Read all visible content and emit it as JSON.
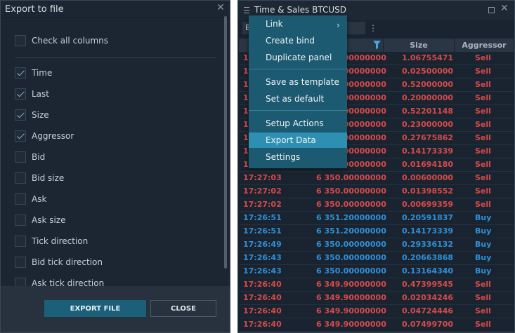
{
  "export_dialog": {
    "title": "Export to file",
    "check_all": "Check all columns",
    "columns": [
      {
        "label": "Time",
        "checked": true
      },
      {
        "label": "Last",
        "checked": true
      },
      {
        "label": "Size",
        "checked": true
      },
      {
        "label": "Aggressor",
        "checked": true
      },
      {
        "label": "Bid",
        "checked": false
      },
      {
        "label": "Bid size",
        "checked": false
      },
      {
        "label": "Ask",
        "checked": false
      },
      {
        "label": "Ask size",
        "checked": false
      },
      {
        "label": "Tick direction",
        "checked": false
      },
      {
        "label": "Bid tick direction",
        "checked": false
      },
      {
        "label": "Ask tick direction",
        "checked": false
      }
    ],
    "export_label": "EXPORT FILE",
    "close_label": "CLOSE"
  },
  "time_sales": {
    "title": "Time & Sales BTCUSD",
    "toolbar_value": "B",
    "headers": {
      "size": "Size",
      "aggressor": "Aggressor"
    },
    "rows": [
      {
        "time": "17:27:08",
        "price": "6 350.00000000",
        "size": "1.06755471",
        "aggressor": "Sell"
      },
      {
        "time": "17:27:08",
        "price": "6 350.00000000",
        "size": "0.02500000",
        "aggressor": "Sell"
      },
      {
        "time": "17:27:08",
        "price": "6 350.00000000",
        "size": "0.52000000",
        "aggressor": "Sell"
      },
      {
        "time": "17:27:08",
        "price": "6 350.00000000",
        "size": "0.20000000",
        "aggressor": "Sell"
      },
      {
        "time": "17:27:08",
        "price": "6 350.00000000",
        "size": "0.52201148",
        "aggressor": "Sell"
      },
      {
        "time": "17:27:08",
        "price": "6 350.00000000",
        "size": "0.23000000",
        "aggressor": "Sell"
      },
      {
        "time": "17:27:08",
        "price": "6 350.00000000",
        "size": "0.27675862",
        "aggressor": "Sell"
      },
      {
        "time": "17:27:08",
        "price": "6 350.00000000",
        "size": "0.14173339",
        "aggressor": "Sell"
      },
      {
        "time": "17:27:08",
        "price": "6 350.00000000",
        "size": "0.01694180",
        "aggressor": "Sell"
      },
      {
        "time": "17:27:03",
        "price": "6 350.00000000",
        "size": "0.00600000",
        "aggressor": "Sell"
      },
      {
        "time": "17:27:02",
        "price": "6 350.00000000",
        "size": "0.01398552",
        "aggressor": "Sell"
      },
      {
        "time": "17:27:02",
        "price": "6 350.00000000",
        "size": "0.00699359",
        "aggressor": "Sell"
      },
      {
        "time": "17:26:51",
        "price": "6 351.20000000",
        "size": "0.20591837",
        "aggressor": "Buy"
      },
      {
        "time": "17:26:51",
        "price": "6 351.20000000",
        "size": "0.14173339",
        "aggressor": "Buy"
      },
      {
        "time": "17:26:49",
        "price": "6 350.00000000",
        "size": "0.29336132",
        "aggressor": "Buy"
      },
      {
        "time": "17:26:43",
        "price": "6 350.00000000",
        "size": "0.20663868",
        "aggressor": "Buy"
      },
      {
        "time": "17:26:43",
        "price": "6 350.00000000",
        "size": "0.13164340",
        "aggressor": "Buy"
      },
      {
        "time": "17:26:40",
        "price": "6 349.90000000",
        "size": "0.47399545",
        "aggressor": "Sell"
      },
      {
        "time": "17:26:40",
        "price": "6 349.90000000",
        "size": "0.02034246",
        "aggressor": "Sell"
      },
      {
        "time": "17:26:40",
        "price": "6 349.90000000",
        "size": "0.04724446",
        "aggressor": "Sell"
      },
      {
        "time": "17:26:40",
        "price": "6 349.90000000",
        "size": "0.07499700",
        "aggressor": "Sell"
      }
    ]
  },
  "context_menu": {
    "items": [
      "Link",
      "Create bind",
      "Duplicate panel",
      "Save as template",
      "Set as default",
      "Setup Actions",
      "Export Data",
      "Settings"
    ],
    "highlighted": "Export Data"
  },
  "colors": {
    "sell": "#d54a4a",
    "buy": "#2f8fd9",
    "menu_bg": "#1c5a71",
    "menu_highlight": "#2f8fb3",
    "export_button": "#1b5f78"
  },
  "icons": [
    "close-icon",
    "menu-icon",
    "maximize-icon",
    "filter-icon",
    "more-icon",
    "chevron-right-icon",
    "checkmark-icon"
  ]
}
